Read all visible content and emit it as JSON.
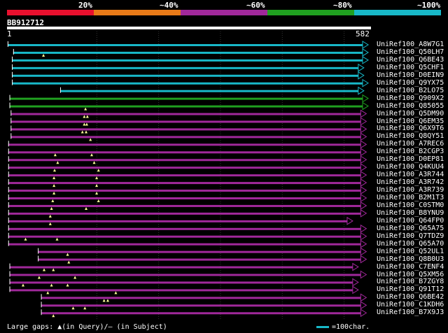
{
  "scale": {
    "labels": [
      "20%",
      "~40%",
      "~60%",
      "~80%",
      "~100%"
    ],
    "colors": [
      "#e8102e",
      "#e87a18",
      "#a0289a",
      "#20a020",
      "#18b8c8"
    ]
  },
  "query": {
    "title": "BB912712",
    "start": "1",
    "end": "582"
  },
  "hits": [
    {
      "label": "UniRef100_A8W7G1",
      "color": "#18b8c8",
      "start": 1,
      "end": 582,
      "marks": []
    },
    {
      "label": "UniRef100_Q50LH7",
      "color": "#18b8c8",
      "start": 10,
      "end": 582,
      "marks": [
        59
      ]
    },
    {
      "label": "UniRef100_Q6BE43",
      "color": "#18b8c8",
      "start": 8,
      "end": 582,
      "marks": []
    },
    {
      "label": "UniRef100_Q5CHF1",
      "color": "#18b8c8",
      "start": 8,
      "end": 575,
      "marks": []
    },
    {
      "label": "UniRef100_D0EIN9",
      "color": "#18b8c8",
      "start": 8,
      "end": 575,
      "marks": []
    },
    {
      "label": "UniRef100_Q9YX75",
      "color": "#18b8c8",
      "start": 8,
      "end": 582,
      "marks": []
    },
    {
      "label": "UniRef100_B2LO75",
      "color": "#18b8c8",
      "start": 86,
      "end": 575,
      "marks": []
    },
    {
      "label": "UniRef100_Q909X2",
      "color": "#20a020",
      "start": 4,
      "end": 582,
      "marks": []
    },
    {
      "label": "UniRef100_Q85055",
      "color": "#20a020",
      "start": 4,
      "end": 582,
      "marks": [
        127
      ]
    },
    {
      "label": "UniRef100_Q5DM90",
      "color": "#a0289a",
      "start": 6,
      "end": 579,
      "marks": [
        125,
        130
      ]
    },
    {
      "label": "UniRef100_Q6EM35",
      "color": "#a0289a",
      "start": 6,
      "end": 579,
      "marks": [
        125,
        129
      ]
    },
    {
      "label": "UniRef100_Q6X9T6",
      "color": "#a0289a",
      "start": 6,
      "end": 579,
      "marks": [
        122,
        128
      ]
    },
    {
      "label": "UniRef100_Q8QY51",
      "color": "#a0289a",
      "start": 6,
      "end": 579,
      "marks": [
        135
      ]
    },
    {
      "label": "UniRef100_A7REC6",
      "color": "#a0289a",
      "start": 2,
      "end": 579,
      "marks": []
    },
    {
      "label": "UniRef100_B2CGP3",
      "color": "#a0289a",
      "start": 2,
      "end": 579,
      "marks": [
        78,
        137
      ]
    },
    {
      "label": "UniRef100_D0EP81",
      "color": "#a0289a",
      "start": 2,
      "end": 579,
      "marks": [
        82,
        141
      ]
    },
    {
      "label": "UniRef100_Q4KUU4",
      "color": "#a0289a",
      "start": 2,
      "end": 579,
      "marks": [
        77,
        148
      ]
    },
    {
      "label": "UniRef100_A3R744",
      "color": "#a0289a",
      "start": 2,
      "end": 579,
      "marks": [
        76,
        145
      ]
    },
    {
      "label": "UniRef100_A3R742",
      "color": "#a0289a",
      "start": 2,
      "end": 579,
      "marks": [
        76,
        145
      ]
    },
    {
      "label": "UniRef100_A3R739",
      "color": "#a0289a",
      "start": 2,
      "end": 579,
      "marks": [
        76,
        145
      ]
    },
    {
      "label": "UniRef100_B2M1T3",
      "color": "#a0289a",
      "start": 2,
      "end": 579,
      "marks": [
        74,
        148
      ]
    },
    {
      "label": "UniRef100_C0STM0",
      "color": "#a0289a",
      "start": 2,
      "end": 579,
      "marks": [
        72,
        128
      ]
    },
    {
      "label": "UniRef100_B8YNU9",
      "color": "#a0289a",
      "start": 2,
      "end": 579,
      "marks": [
        70
      ]
    },
    {
      "label": "UniRef100_Q64FP0",
      "color": "#a0289a",
      "start": 2,
      "end": 557,
      "marks": [
        70
      ]
    },
    {
      "label": "UniRef100_Q65A75",
      "color": "#a0289a",
      "start": 2,
      "end": 579,
      "marks": []
    },
    {
      "label": "UniRef100_Q7TDZ9",
      "color": "#a0289a",
      "start": 2,
      "end": 579,
      "marks": [
        30,
        81
      ]
    },
    {
      "label": "UniRef100_Q65A70",
      "color": "#a0289a",
      "start": 2,
      "end": 579,
      "marks": []
    },
    {
      "label": "UniRef100_Q52UL1",
      "color": "#a0289a",
      "start": 50,
      "end": 579,
      "marks": [
        98
      ]
    },
    {
      "label": "UniRef100_Q8B0U3",
      "color": "#a0289a",
      "start": 50,
      "end": 579,
      "marks": [
        100
      ]
    },
    {
      "label": "UniRef100_C7ENF4",
      "color": "#a0289a",
      "start": 4,
      "end": 566,
      "marks": [
        60,
        75
      ]
    },
    {
      "label": "UniRef100_Q5XM56",
      "color": "#a0289a",
      "start": 4,
      "end": 579,
      "marks": [
        52,
        110
      ]
    },
    {
      "label": "UniRef100_B7ZGY8",
      "color": "#a0289a",
      "start": 4,
      "end": 566,
      "marks": [
        26,
        72,
        98
      ]
    },
    {
      "label": "UniRef100_Q91T12",
      "color": "#a0289a",
      "start": 4,
      "end": 566,
      "marks": [
        66,
        176
      ]
    },
    {
      "label": "UniRef100_Q6BE42",
      "color": "#a0289a",
      "start": 55,
      "end": 579,
      "marks": [
        157,
        163
      ]
    },
    {
      "label": "UniRef100_C1KDH6",
      "color": "#a0289a",
      "start": 55,
      "end": 579,
      "marks": [
        107,
        126
      ]
    },
    {
      "label": "UniRef100_B7X9J3",
      "color": "#a0289a",
      "start": 55,
      "end": 579,
      "marks": [
        75
      ]
    }
  ],
  "footer": {
    "text": "Large gaps: ▲(in Query)/– (in Subject)",
    "legend": "=100char."
  }
}
